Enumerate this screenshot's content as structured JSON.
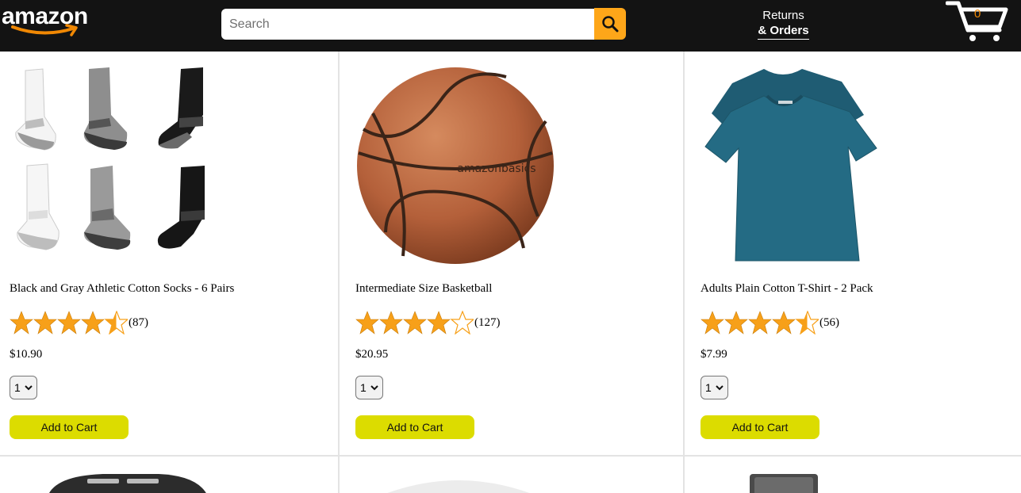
{
  "header": {
    "logo_text": "amazon",
    "search": {
      "placeholder": "Search",
      "value": ""
    },
    "returns_top": "Returns",
    "returns_bottom": "& Orders",
    "cart_count": "0",
    "colors": {
      "bg": "#131313",
      "search_btn": "#fea619",
      "cart_count": "#f08804"
    }
  },
  "products": [
    {
      "name": "Black and Gray Athletic Cotton Socks - 6 Pairs",
      "rating_stars": 4.5,
      "rating_count": "(87)",
      "price": "$10.90",
      "quantity": "1",
      "add_label": "Add to Cart"
    },
    {
      "name": "Intermediate Size Basketball",
      "rating_stars": 4.0,
      "rating_count": "(127)",
      "price": "$20.95",
      "quantity": "1",
      "add_label": "Add to Cart"
    },
    {
      "name": "Adults Plain Cotton T-Shirt - 2 Pack",
      "rating_stars": 4.5,
      "rating_count": "(56)",
      "price": "$7.99",
      "quantity": "1",
      "add_label": "Add to Cart"
    }
  ],
  "basketball_logo_text": "amazonbasics",
  "colors": {
    "star": "#f7a019",
    "add_button": "#dcdc00",
    "divider": "#e3e3e3"
  }
}
